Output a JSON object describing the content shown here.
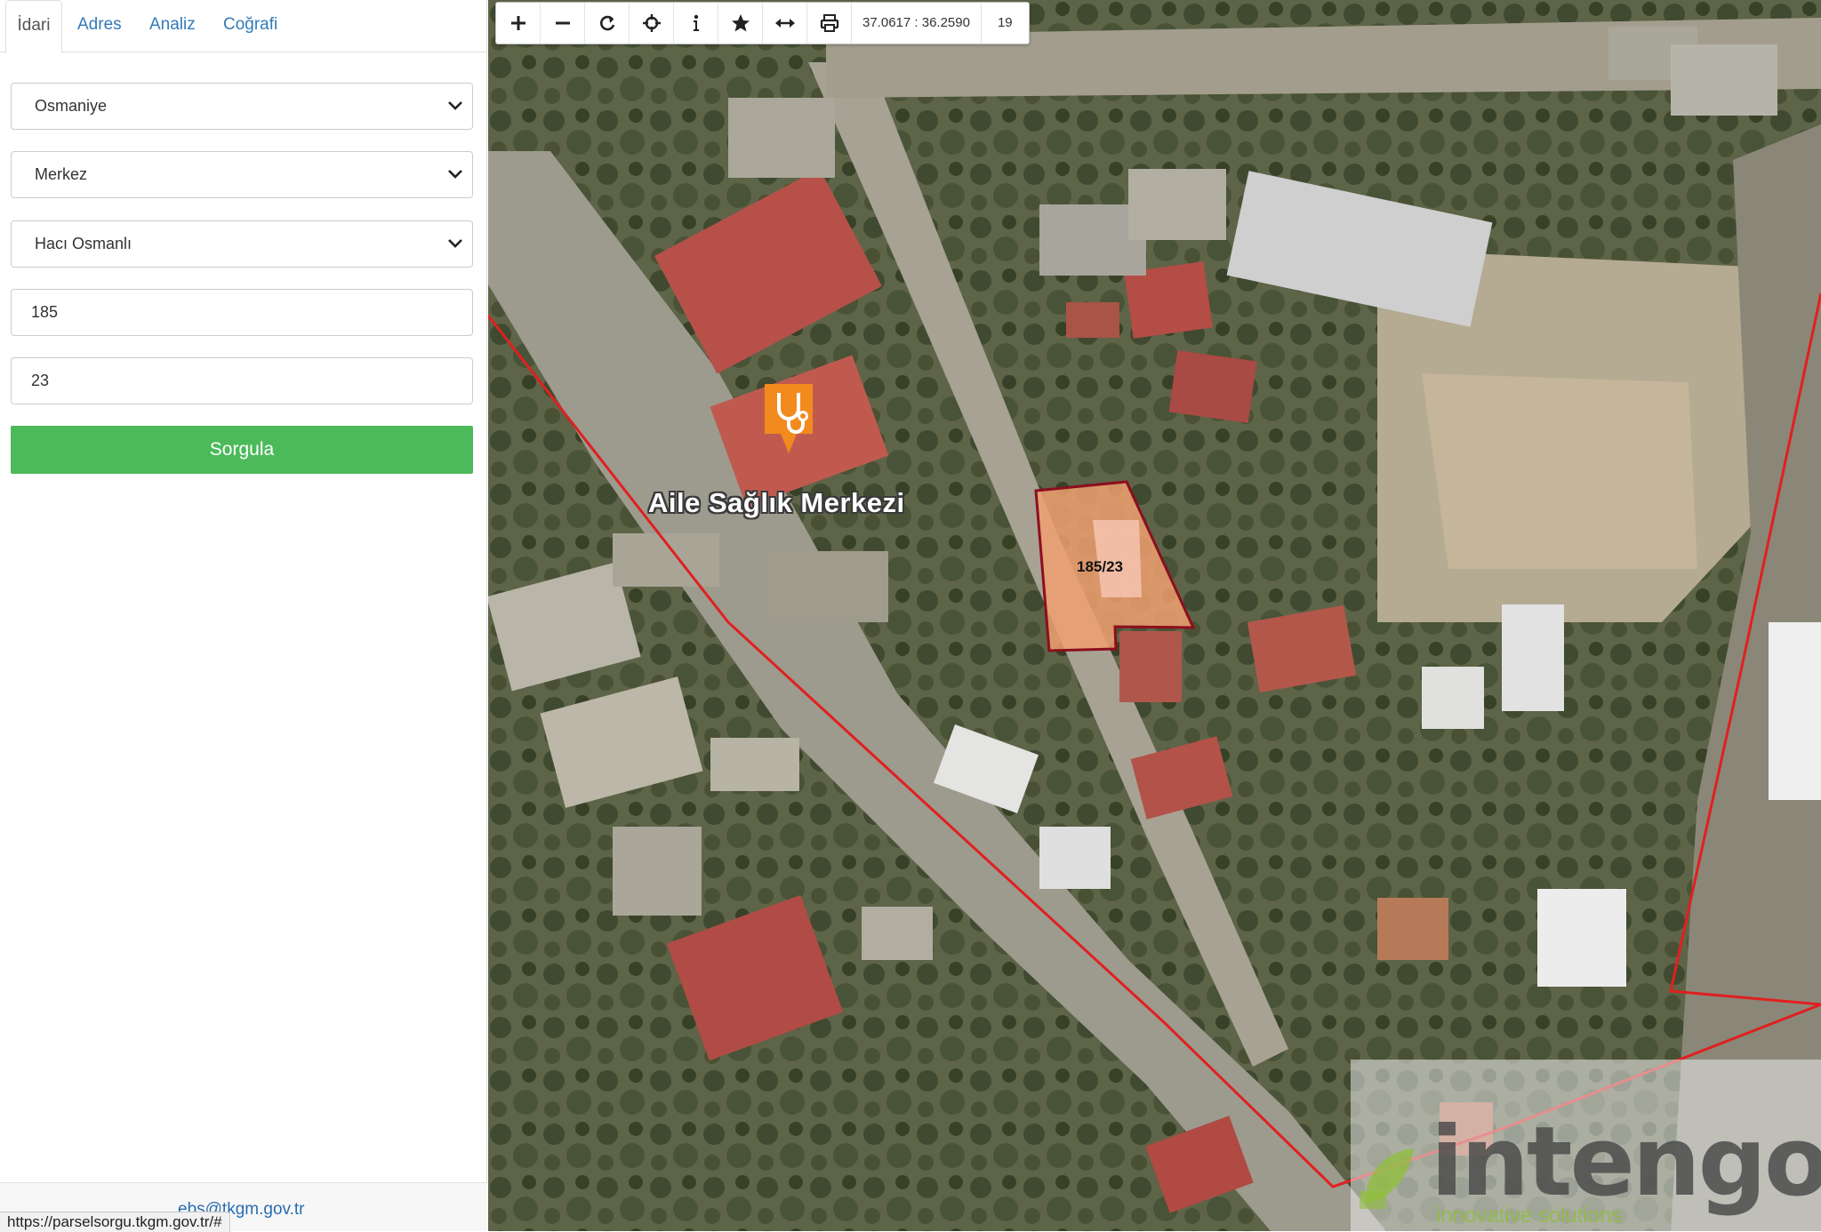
{
  "tabs": [
    {
      "label": "İdari",
      "active": true
    },
    {
      "label": "Adres",
      "active": false
    },
    {
      "label": "Analiz",
      "active": false
    },
    {
      "label": "Coğrafi",
      "active": false
    }
  ],
  "form": {
    "province": "Osmaniye",
    "district": "Merkez",
    "neighborhood": "Hacı Osmanlı",
    "block_no": "185",
    "parcel_no": "23",
    "submit_label": "Sorgula"
  },
  "footer": {
    "email_partial": "ebs@tkgm.gov.tr",
    "status_url": "https://parselsorgu.tkgm.gov.tr/#"
  },
  "toolbar": {
    "buttons": [
      "zoom-in-icon",
      "zoom-out-icon",
      "refresh-icon",
      "locate-icon",
      "info-icon",
      "star-icon",
      "measure-icon",
      "print-icon"
    ],
    "coordinates": "37.0617 : 36.2590",
    "zoom_level": "19"
  },
  "map": {
    "poi_label": "Aile Sağlık Merkezi",
    "poi_icon": "stethoscope-icon",
    "parcel_label": "185/23",
    "watermark_brand": "intengo",
    "watermark_tagline": "innovative solutions",
    "colors": {
      "boundary_line": "#e02020",
      "parcel_outline": "#8b0f1e",
      "parcel_fill": "#f0a070",
      "marker": "#f28a1e",
      "submit_button": "#4cba5a"
    }
  }
}
